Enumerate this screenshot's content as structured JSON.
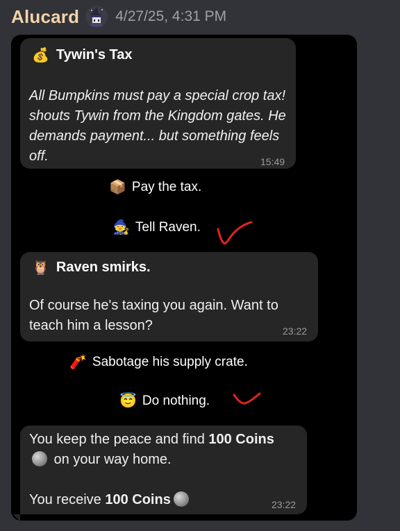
{
  "header": {
    "username": "Alucard",
    "timestamp": "4/27/25, 4:31 PM",
    "avatar_icon": "witch-hat-avatar-icon"
  },
  "messages": [
    {
      "title_emoji": "💰",
      "title": "Tywin's Tax",
      "body": "All Bumpkins must pay a special crop tax! shouts Tywin from the Kingdom gates. He demands payment... but something feels off.",
      "time": "15:49"
    },
    {
      "title_emoji": "🦉",
      "title": "Raven smirks.",
      "body": "Of course he's taxing you again. Want to teach him a lesson?",
      "time": "23:22"
    },
    {
      "body_part1": "You keep the peace and find ",
      "body_bold1": "100 Coins",
      "body_part2": " on your way home.",
      "body_part3": "You receive ",
      "body_bold2": "100 Coins",
      "time": "23:22"
    }
  ],
  "choices": [
    {
      "emoji": "📦",
      "label": "Pay the tax."
    },
    {
      "emoji": "🧙",
      "label": "Tell Raven."
    },
    {
      "emoji": "🧨",
      "label": "Sabotage his supply crate."
    },
    {
      "emoji": "😇",
      "label": "Do nothing."
    }
  ],
  "annotations": {
    "checkmark_color": "#e0241d"
  }
}
